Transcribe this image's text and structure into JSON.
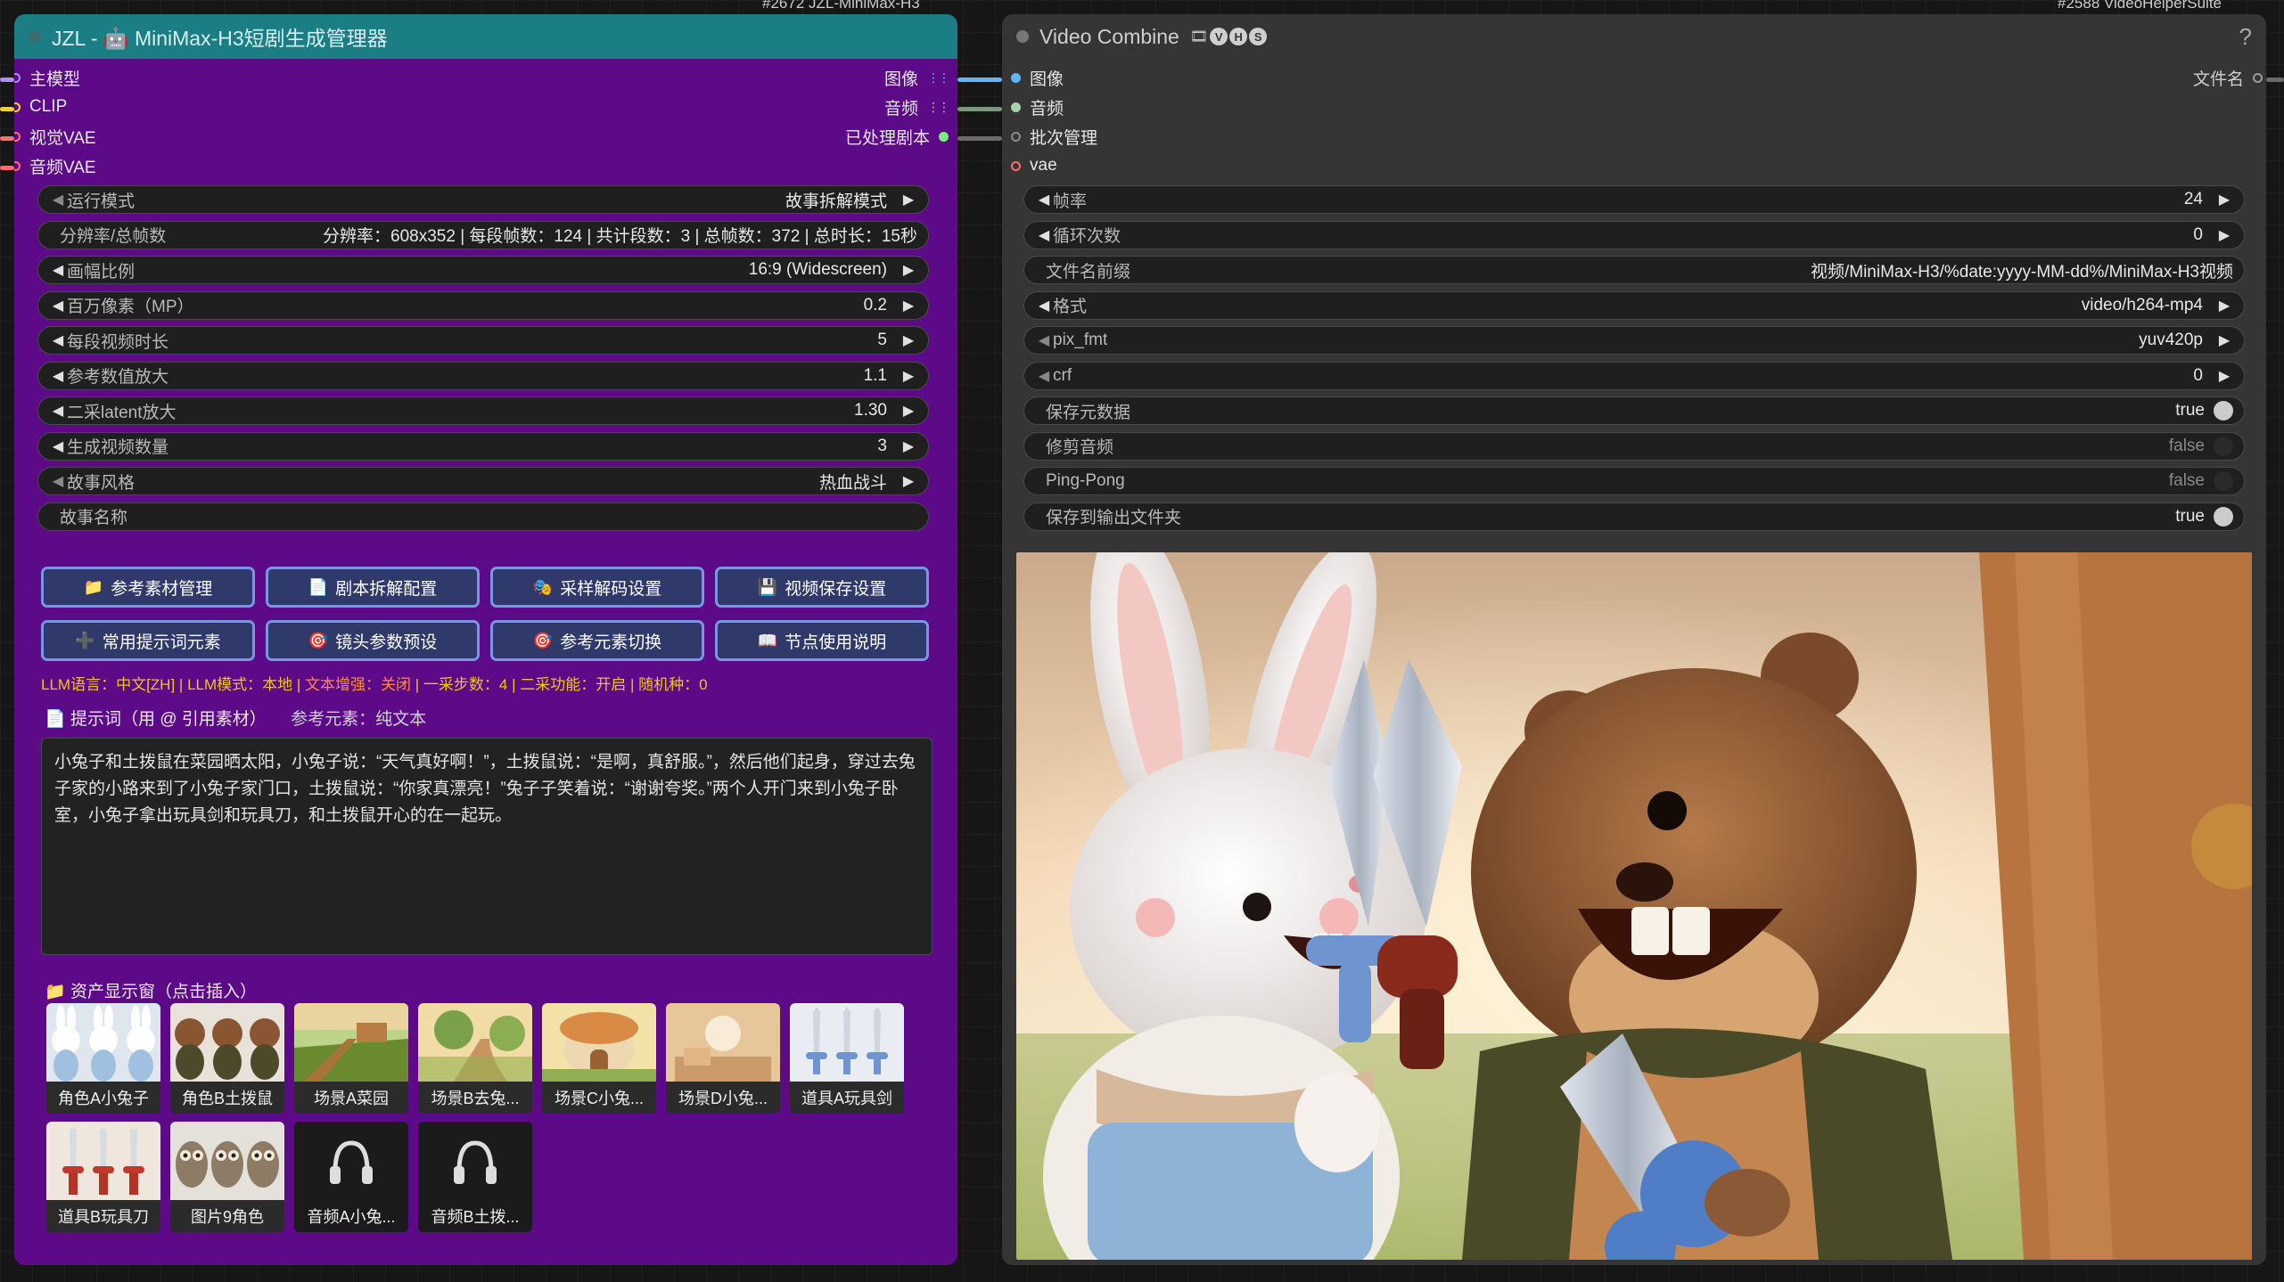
{
  "nodeA": {
    "id_label": "#2672 JZL-MiniMax-H3",
    "title": "JZL - 🤖 MiniMax-H3短剧生成管理器",
    "inputs": [
      {
        "label": "主模型",
        "color": "#b08cf5"
      },
      {
        "label": "CLIP",
        "color": "#f2cf3a"
      },
      {
        "label": "视觉VAE",
        "color": "#ff6e6e"
      },
      {
        "label": "音频VAE",
        "color": "#ff6e6e"
      }
    ],
    "outputs": [
      {
        "label": "图像",
        "color": "#64b5f6"
      },
      {
        "label": "音频",
        "color": "#a5d6a7"
      },
      {
        "label": "已处理剧本",
        "color": "#7cf07c"
      }
    ],
    "widgets": [
      {
        "label": "运行模式",
        "value": "故事拆解模式",
        "arrows": true,
        "left_dim": true
      },
      {
        "label": "分辨率/总帧数",
        "value": "分辨率：608x352 | 每段帧数：124 | 共计段数：3 | 总帧数：372 | 总时长：15秒",
        "arrows": false
      },
      {
        "label": "画幅比例",
        "value": "16:9 (Widescreen)",
        "arrows": true
      },
      {
        "label": "百万像素（MP）",
        "value": "0.2",
        "arrows": true
      },
      {
        "label": "每段视频时长",
        "value": "5",
        "arrows": true
      },
      {
        "label": "参考数值放大",
        "value": "1.1",
        "arrows": true
      },
      {
        "label": "二采latent放大",
        "value": "1.30",
        "arrows": true
      },
      {
        "label": "生成视频数量",
        "value": "3",
        "arrows": true
      },
      {
        "label": "故事风格",
        "value": "热血战斗",
        "arrows": true,
        "left_dim": true
      },
      {
        "label": "故事名称",
        "value": "",
        "arrows": false
      }
    ],
    "buttons": [
      {
        "icon": "📁",
        "label": "参考素材管理"
      },
      {
        "icon": "📄",
        "label": "剧本拆解配置"
      },
      {
        "icon": "🎭",
        "label": "采样解码设置"
      },
      {
        "icon": "💾",
        "label": "视频保存设置"
      },
      {
        "icon": "➕",
        "label": "常用提示词元素"
      },
      {
        "icon": "🎯",
        "label": "镜头参数预设"
      },
      {
        "icon": "🎯",
        "label": "参考元素切换"
      },
      {
        "icon": "📖",
        "label": "节点使用说明"
      }
    ],
    "status": [
      {
        "text": "LLM语言：中文[ZH]",
        "color": "#f0c419"
      },
      {
        "text": " | ",
        "color": "#f0c419"
      },
      {
        "text": "LLM模式：本地",
        "color": "#f0c419"
      },
      {
        "text": " | ",
        "color": "#f0c419"
      },
      {
        "text": "文本增强：关闭",
        "color": "#ff8a3d"
      },
      {
        "text": " | ",
        "color": "#f0c419"
      },
      {
        "text": "一采步数：4",
        "color": "#f0c419"
      },
      {
        "text": " | ",
        "color": "#f0c419"
      },
      {
        "text": "二采功能：开启",
        "color": "#f0c419"
      },
      {
        "text": " | ",
        "color": "#f0c419"
      },
      {
        "text": "随机种：0",
        "color": "#f0c419"
      }
    ],
    "prompt_header": "提示词（用 @ 引用素材）",
    "ref_element": "参考元素：纯文本",
    "prompt_text": "小兔子和土拨鼠在菜园晒太阳，小兔子说：“天气真好啊！”，土拨鼠说：“是啊，真舒服。”，然后他们起身，穿过去兔子家的小路来到了小兔子家门口，土拨鼠说：“你家真漂亮！”兔子子笑着说：“谢谢夸奖。”两个人开门来到小兔子卧室，小兔子拿出玩具剑和玩具刀，和土拨鼠开心的在一起玩。",
    "assets_header": "资产显示窗（点击插入）",
    "assets": [
      {
        "label": "角色A小兔子",
        "kind": "rabbits"
      },
      {
        "label": "角色B土拨鼠",
        "kind": "beavers"
      },
      {
        "label": "场景A菜园",
        "kind": "garden"
      },
      {
        "label": "场景B去兔...",
        "kind": "path"
      },
      {
        "label": "场景C小兔...",
        "kind": "house"
      },
      {
        "label": "场景D小兔...",
        "kind": "room"
      },
      {
        "label": "道具A玩具剑",
        "kind": "swords"
      },
      {
        "label": "道具B玩具刀",
        "kind": "knives"
      },
      {
        "label": "图片9角色",
        "kind": "owls"
      },
      {
        "label": "音频A小兔...",
        "kind": "audio"
      },
      {
        "label": "音频B土拨...",
        "kind": "audio"
      }
    ]
  },
  "nodeB": {
    "id_label": "#2588 VideoHelperSuite",
    "title": "Video Combine",
    "badges": [
      "V",
      "H",
      "S"
    ],
    "help": "?",
    "inputs": [
      {
        "label": "图像",
        "color": "#64b5f6"
      },
      {
        "label": "音频",
        "color": "#a5d6a7"
      },
      {
        "label": "批次管理",
        "color": "#8a8a8a"
      },
      {
        "label": "vae",
        "color": "#ff6e6e"
      }
    ],
    "output": {
      "label": "文件名",
      "color": "#9a9a9a"
    },
    "widgets": [
      {
        "label": "帧率",
        "value": "24",
        "type": "arrows"
      },
      {
        "label": "循环次数",
        "value": "0",
        "type": "arrows"
      },
      {
        "label": "文件名前缀",
        "value": "视频/MiniMax-H3/%date:yyyy-MM-dd%/MiniMax-H3视频",
        "type": "text"
      },
      {
        "label": "格式",
        "value": "video/h264-mp4",
        "type": "arrows"
      },
      {
        "label": "pix_fmt",
        "value": "yuv420p",
        "type": "arrows",
        "left_dim": true
      },
      {
        "label": "crf",
        "value": "0",
        "type": "arrows",
        "left_dim": true
      },
      {
        "label": "保存元数据",
        "value": "true",
        "type": "toggle",
        "on": true
      },
      {
        "label": "修剪音频",
        "value": "false",
        "type": "toggle",
        "on": false
      },
      {
        "label": "Ping-Pong",
        "value": "false",
        "type": "toggle",
        "on": false
      },
      {
        "label": "保存到输出文件夹",
        "value": "true",
        "type": "toggle",
        "on": true
      }
    ]
  }
}
